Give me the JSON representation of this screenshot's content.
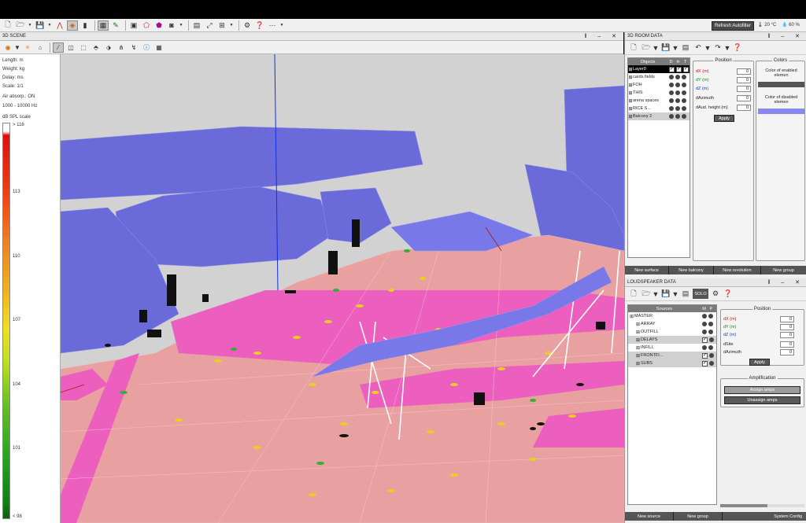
{
  "toolbar": {
    "refresh_label": "Refresh Autofilter",
    "temperature": "20 °C",
    "humidity": "60 %"
  },
  "scene": {
    "title": "3D SCENE",
    "units": {
      "length": "Length: m",
      "weight": "Weight: kg",
      "delay": "Delay: ms",
      "scale": "Scale: 1/1"
    },
    "air": "Air absorp.: ON",
    "band": "1000 - 10000 Hz",
    "spl_title": "dB SPL scale",
    "ticks": [
      "> 116",
      "113",
      "110",
      "107",
      "104",
      "101",
      "< 98"
    ]
  },
  "room": {
    "title": "3D ROOM DATA",
    "columns": {
      "objects": "Objects",
      "d": "D",
      "h": "H",
      "t": "T"
    },
    "objects": [
      {
        "label": "Layer0",
        "style": "hl"
      },
      {
        "label": "cards fields",
        "style": ""
      },
      {
        "label": "FOH",
        "style": ""
      },
      {
        "label": "THIS",
        "style": ""
      },
      {
        "label": "arena spaces",
        "style": ""
      },
      {
        "label": "RICE S...",
        "style": ""
      },
      {
        "label": "Balcony 2",
        "style": "gr"
      }
    ],
    "position": {
      "legend": "Position",
      "dx_label": "dX (m)",
      "dx": "0",
      "dy_label": "dY (m)",
      "dy": "0",
      "dz_label": "dZ (m)",
      "dz": "0",
      "dazimuth_label": "dAzimuth",
      "dazimuth": "0",
      "daud_label": "dAud. height (m)",
      "daud": "0",
      "apply": "Apply"
    },
    "colors": {
      "legend": "Colors",
      "enabled": "Color of enabled elemen",
      "disabled": "Color of disabled elemen",
      "enabled_color": "#555555",
      "disabled_color": "#8888f0"
    },
    "buttons": {
      "surface": "New surface",
      "balcony": "New balcony",
      "revolution": "New revolution",
      "group": "New group"
    }
  },
  "speaker": {
    "title": "LOUDSPEAKER DATA",
    "solo": "SOLO",
    "columns": {
      "sources": "Sources",
      "m": "M",
      "p": "P"
    },
    "sources": [
      {
        "label": "MASTER",
        "style": "",
        "check": false
      },
      {
        "label": "ARRAY",
        "style": "",
        "check": false
      },
      {
        "label": "OUTFILL",
        "style": "",
        "check": false
      },
      {
        "label": "DELAYS",
        "style": "gr",
        "check": true
      },
      {
        "label": "INFILL",
        "style": "",
        "check": false
      },
      {
        "label": "FRONTFI...",
        "style": "gr",
        "check": true
      },
      {
        "label": "SUBS",
        "style": "gr",
        "check": true
      }
    ],
    "position": {
      "legend": "Position",
      "dx_label": "dX (m)",
      "dx": "0",
      "dy_label": "dY (m)",
      "dy": "0",
      "dz_label": "dZ (m)",
      "dz": "0",
      "dsite_label": "dSite",
      "dsite": "0",
      "dazimuth_label": "dAzimuth",
      "dazimuth": "0",
      "apply": "Apply"
    },
    "amp": {
      "legend": "Amplification",
      "assign": "Assign amps",
      "unassign": "Unassign amps"
    },
    "buttons": {
      "source": "New source",
      "group": "New group",
      "config": "System Config"
    }
  }
}
